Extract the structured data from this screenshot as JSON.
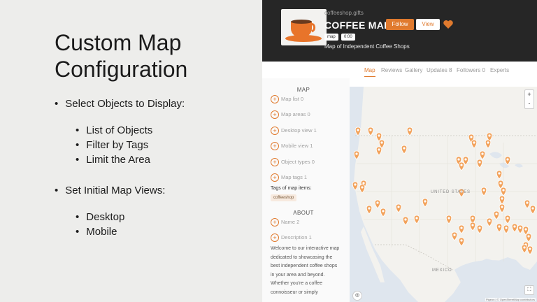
{
  "slide": {
    "title_line1": "Custom Map",
    "title_line2": "Configuration",
    "bullet1": "Select Objects to Display:",
    "sub1": [
      "List of Objects",
      "Filter by Tags",
      "Limit the Area"
    ],
    "bullet2": "Set Initial Map Views:",
    "sub2": [
      "Desktop",
      "Mobile"
    ]
  },
  "header": {
    "site": "coffeeshop.gifts",
    "title": "COFFEE MAP",
    "follow_label": "Follow",
    "view_label": "View",
    "tag_map": "map",
    "tag_count": "0:00",
    "subtitle": "Map of Independent Coffee Shops",
    "accent": "#e07a2e"
  },
  "tabs": [
    "Map",
    "Reviews",
    "Gallery",
    "Updates 8",
    "Followers 0",
    "Experts"
  ],
  "sidebar": {
    "map_heading": "MAP",
    "map_items": [
      "Map list 0",
      "Map areas 0",
      "Desktop view 1",
      "Mobile view 1",
      "Object types 0",
      "Map tags 1"
    ],
    "tags_label": "Tags of map items:",
    "tag_chip": "coffeeshop",
    "about_heading": "ABOUT",
    "about_items": [
      "Name 2",
      "Description 1"
    ],
    "description": "Welcome to our interactive map dedicated to showcasing the best independent coffee shops in your area and beyond. Whether you're a coffee connoisseur or simply"
  },
  "map": {
    "label_us": "UNITED STATES",
    "label_mx": "MEXICO",
    "zoom_in": "+",
    "zoom_out": "-",
    "attribution": "Pigeon | © OpenStreetMap contributors",
    "pin_color": "#f2a25b"
  }
}
